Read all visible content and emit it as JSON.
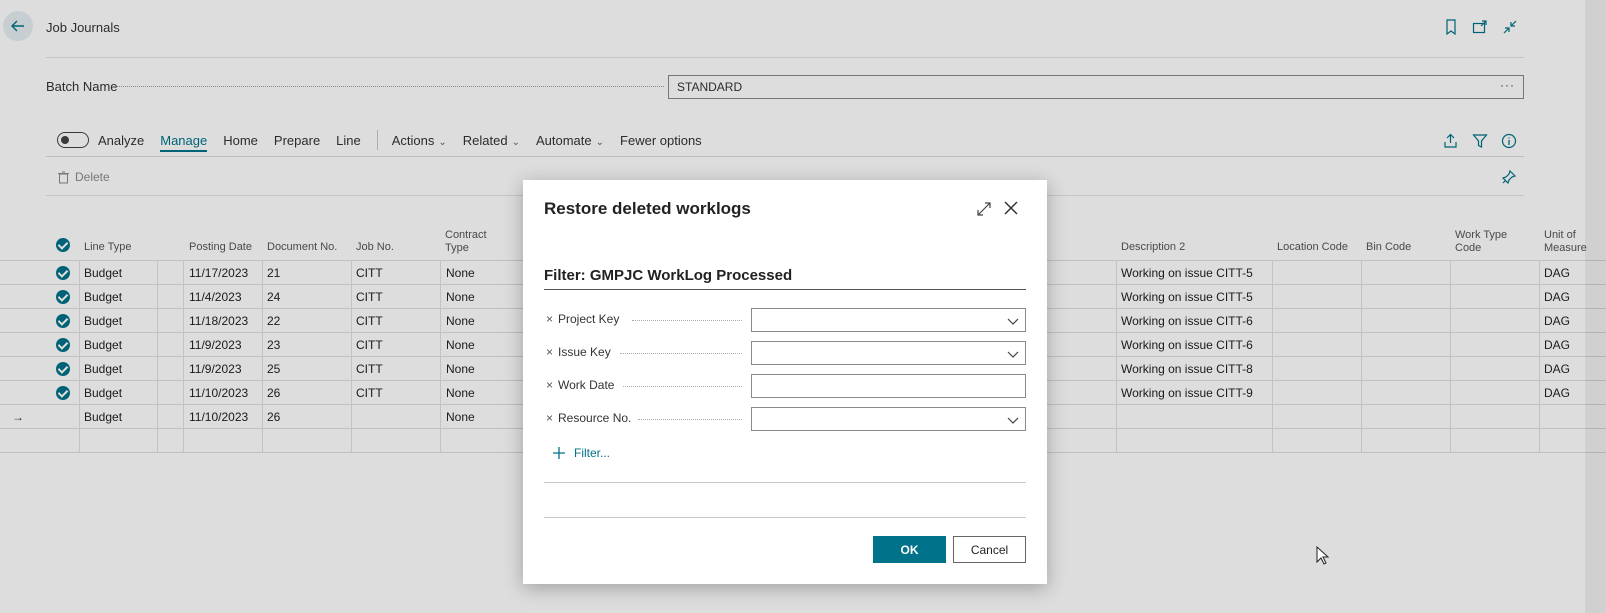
{
  "header": {
    "title": "Job Journals",
    "icons": [
      "back-arrow-icon",
      "bookmark-icon",
      "open-new-window-icon",
      "collapse-icon"
    ]
  },
  "batch": {
    "label": "Batch Name",
    "value": "STANDARD",
    "more": "···"
  },
  "actionbar": {
    "analyze": "Analyze",
    "manage": "Manage",
    "home": "Home",
    "prepare": "Prepare",
    "line": "Line",
    "actions": "Actions",
    "related": "Related",
    "automate": "Automate",
    "fewer": "Fewer options",
    "delete": "Delete"
  },
  "grid": {
    "headers": {
      "line_type": "Line Type",
      "posting_date": "Posting Date",
      "document_no": "Document No.",
      "job_no": "Job No.",
      "contract_type_1": "Contract",
      "contract_type_2": "Type",
      "description2": "Description 2",
      "location_code": "Location Code",
      "bin_code": "Bin Code",
      "work_type_1": "Work Type",
      "work_type_2": "Code",
      "uom_1": "Unit of",
      "uom_2": "Measure"
    },
    "rows": [
      {
        "line_type": "Budget",
        "posting_date": "11/17/2023",
        "document_no": "21",
        "job_no": "CITT",
        "contract_type": "None",
        "description2": "Working on issue CITT-5",
        "uom": "DAG"
      },
      {
        "line_type": "Budget",
        "posting_date": "11/4/2023",
        "document_no": "24",
        "job_no": "CITT",
        "contract_type": "None",
        "description2": "Working on issue CITT-5",
        "uom": "DAG"
      },
      {
        "line_type": "Budget",
        "posting_date": "11/18/2023",
        "document_no": "22",
        "job_no": "CITT",
        "contract_type": "None",
        "description2": "Working on issue CITT-6",
        "uom": "DAG"
      },
      {
        "line_type": "Budget",
        "posting_date": "11/9/2023",
        "document_no": "23",
        "job_no": "CITT",
        "contract_type": "None",
        "description2": "Working on issue CITT-6",
        "uom": "DAG"
      },
      {
        "line_type": "Budget",
        "posting_date": "11/9/2023",
        "document_no": "25",
        "job_no": "CITT",
        "contract_type": "None",
        "description2": "Working on issue CITT-8",
        "uom": "DAG"
      },
      {
        "line_type": "Budget",
        "posting_date": "11/10/2023",
        "document_no": "26",
        "job_no": "CITT",
        "contract_type": "None",
        "description2": "Working on issue CITT-9",
        "uom": "DAG"
      },
      {
        "line_type": "Budget",
        "posting_date": "11/10/2023",
        "document_no": "26",
        "job_no": "",
        "contract_type": "None",
        "description2": "",
        "uom": "",
        "current": true
      }
    ]
  },
  "dialog": {
    "title": "Restore deleted worklogs",
    "filter_title": "Filter: GMPJC WorkLog Processed",
    "fields": [
      {
        "label": "Project Key",
        "value": "",
        "type": "dropdown"
      },
      {
        "label": "Issue Key",
        "value": "",
        "type": "dropdown"
      },
      {
        "label": "Work Date",
        "value": "",
        "type": "text"
      },
      {
        "label": "Resource No.",
        "value": "",
        "type": "dropdown"
      }
    ],
    "add_filter": "Filter...",
    "ok": "OK",
    "cancel": "Cancel"
  },
  "colors": {
    "accent": "#00728a",
    "overlay": "rgba(0,0,0,0.135)"
  }
}
